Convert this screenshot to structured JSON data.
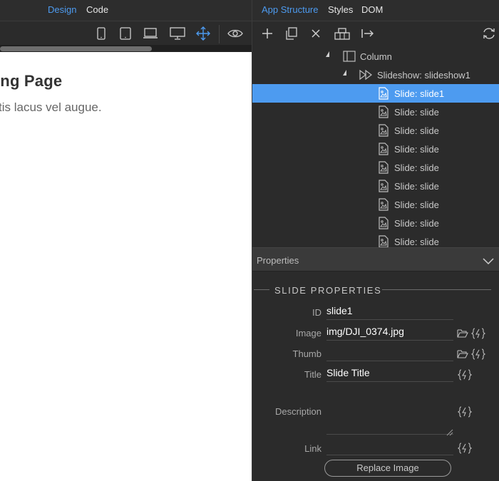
{
  "left_tabs": {
    "design": "Design",
    "code": "Code"
  },
  "canvas": {
    "heading": "ing Page",
    "paragraph": "tis lacus vel augue."
  },
  "right_tabs": {
    "app_structure": "App Structure",
    "styles": "Styles",
    "dom": "DOM"
  },
  "tree": [
    {
      "label": "Column",
      "icon": "column-icon",
      "level": 0,
      "expanded": true
    },
    {
      "label": "Slideshow: slideshow1",
      "icon": "slideshow-icon",
      "level": 1,
      "expanded": true
    },
    {
      "label": "Slide: slide1",
      "icon": "slide-icon",
      "level": 2,
      "selected": true
    },
    {
      "label": "Slide: slide",
      "icon": "slide-icon",
      "level": 2
    },
    {
      "label": "Slide: slide",
      "icon": "slide-icon",
      "level": 2
    },
    {
      "label": "Slide: slide",
      "icon": "slide-icon",
      "level": 2
    },
    {
      "label": "Slide: slide",
      "icon": "slide-icon",
      "level": 2
    },
    {
      "label": "Slide: slide",
      "icon": "slide-icon",
      "level": 2
    },
    {
      "label": "Slide: slide",
      "icon": "slide-icon",
      "level": 2
    },
    {
      "label": "Slide: slide",
      "icon": "slide-icon",
      "level": 2
    },
    {
      "label": "Slide: slide",
      "icon": "slide-icon",
      "level": 2
    }
  ],
  "properties": {
    "header": "Properties",
    "section_title": "SLIDE PROPERTIES",
    "fields": {
      "id": {
        "label": "ID",
        "value": "slide1"
      },
      "image": {
        "label": "Image",
        "value": "img/DJI_0374.jpg"
      },
      "thumb": {
        "label": "Thumb",
        "value": ""
      },
      "title": {
        "label": "Title",
        "value": "Slide Title"
      },
      "description": {
        "label": "Description",
        "value": ""
      },
      "link": {
        "label": "Link",
        "value": ""
      }
    },
    "replace_button": "Replace Image"
  },
  "colors": {
    "accent": "#4d9bf0",
    "panel": "#2b2b2b",
    "selected_row": "#4d9bf0"
  }
}
